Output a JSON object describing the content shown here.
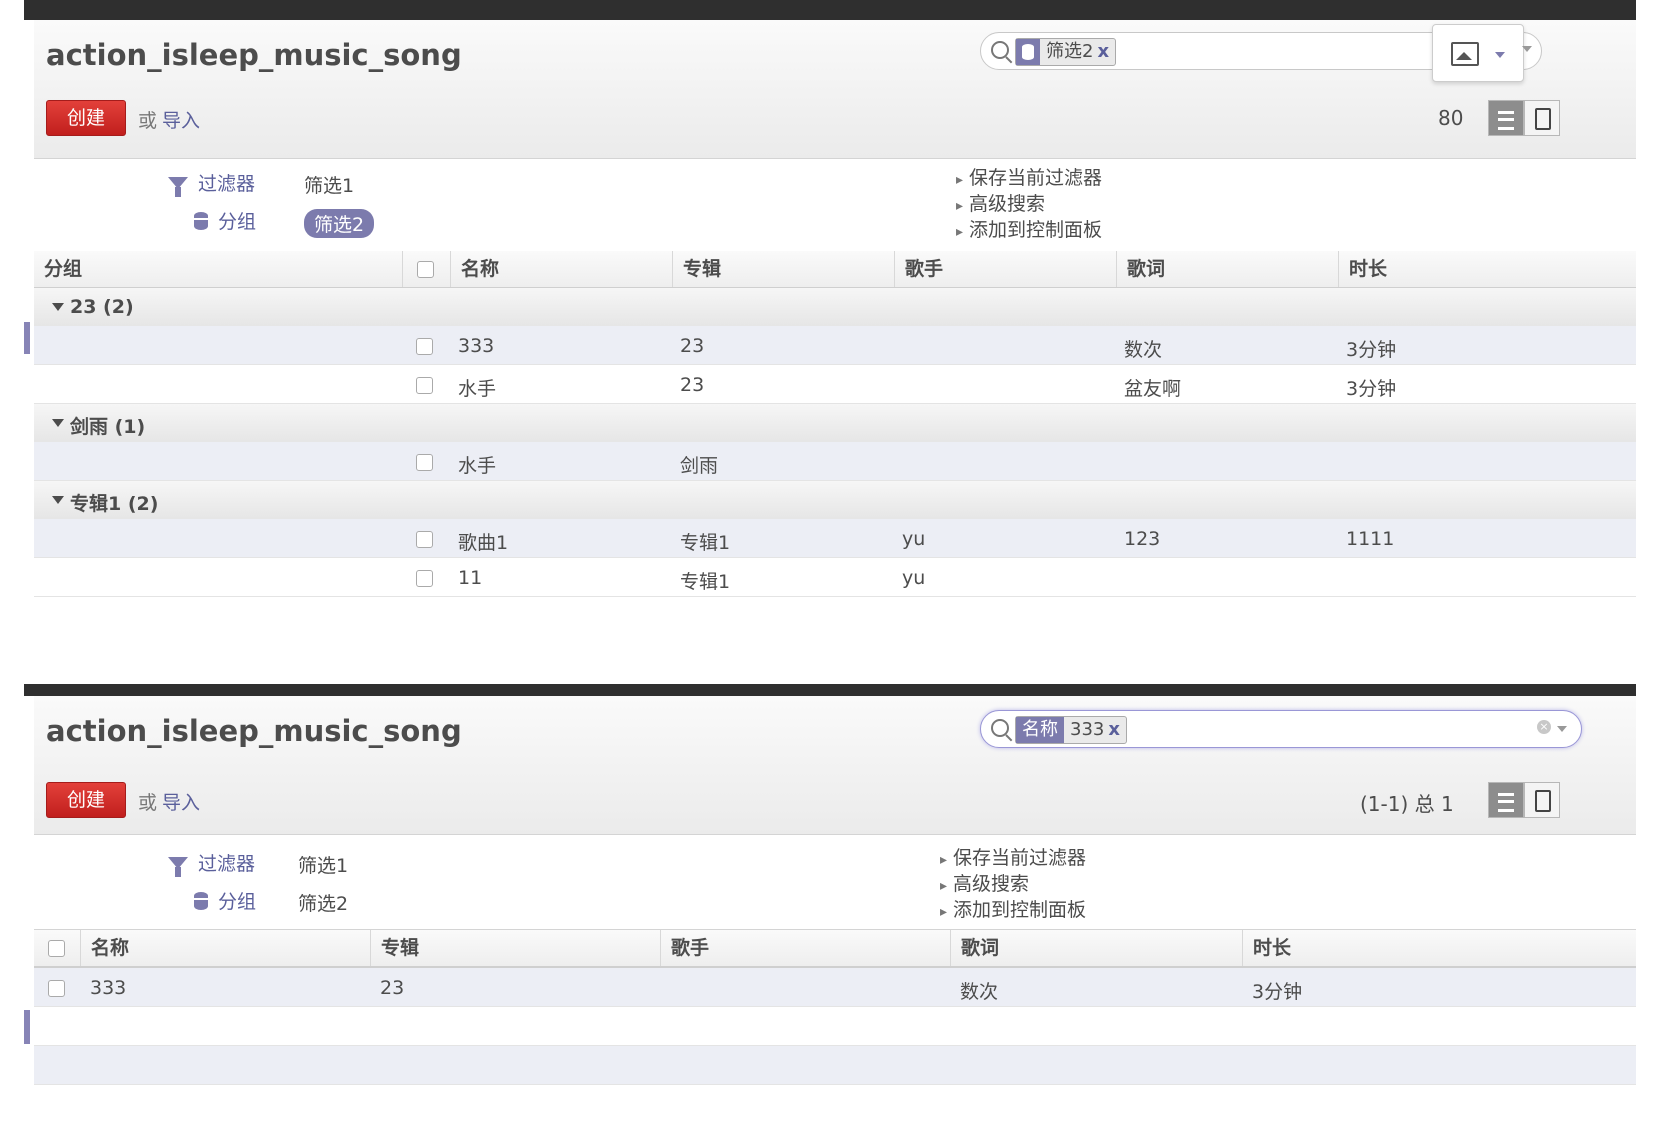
{
  "panel1": {
    "title": "action_isleep_music_song",
    "create_label": "创建",
    "or_text": "或",
    "import_label": "导入",
    "search_facet": {
      "value": "筛选2",
      "remove": "x"
    },
    "pager": "80",
    "filter_label": "过滤器",
    "group_label": "分组",
    "filter_item": "筛选1",
    "group_item": "筛选2",
    "links": [
      "保存当前过滤器",
      "高级搜索",
      "添加到控制面板"
    ],
    "columns": [
      "分组",
      "名称",
      "专辑",
      "歌手",
      "歌词",
      "时长"
    ],
    "groups": [
      {
        "label": "23 (2)",
        "rows": [
          {
            "name": "333",
            "album": "23",
            "singer": "",
            "lyrics": "数次",
            "duration": "3分钟"
          },
          {
            "name": "水手",
            "album": "23",
            "singer": "",
            "lyrics": "盆友啊",
            "duration": "3分钟"
          }
        ]
      },
      {
        "label": "剑雨 (1)",
        "rows": [
          {
            "name": "水手",
            "album": "剑雨",
            "singer": "",
            "lyrics": "",
            "duration": ""
          }
        ]
      },
      {
        "label": "专辑1 (2)",
        "rows": [
          {
            "name": "歌曲1",
            "album": "专辑1",
            "singer": "yu",
            "lyrics": "123",
            "duration": "1111"
          },
          {
            "name": "11",
            "album": "专辑1",
            "singer": "yu",
            "lyrics": "",
            "duration": ""
          }
        ]
      }
    ]
  },
  "panel2": {
    "title": "action_isleep_music_song",
    "create_label": "创建",
    "or_text": "或",
    "import_label": "导入",
    "search_facet": {
      "category": "名称",
      "value": "333",
      "remove": "x"
    },
    "pager": "(1-1) 总 1",
    "filter_label": "过滤器",
    "group_label": "分组",
    "filter_item": "筛选1",
    "group_item": "筛选2",
    "links": [
      "保存当前过滤器",
      "高级搜索",
      "添加到控制面板"
    ],
    "columns": [
      "名称",
      "专辑",
      "歌手",
      "歌词",
      "时长"
    ],
    "rows": [
      {
        "name": "333",
        "album": "23",
        "singer": "",
        "lyrics": "数次",
        "duration": "3分钟"
      }
    ]
  },
  "colors": {
    "accent": "#7c7bad",
    "create": "#d12e2b",
    "link": "#5a5f9b",
    "row_alt": "#eceef5"
  },
  "icons": [
    "search-icon",
    "database-icon",
    "image-icon",
    "caret-down-icon",
    "list-view-icon",
    "form-view-icon",
    "funnel-icon",
    "clear-icon"
  ]
}
